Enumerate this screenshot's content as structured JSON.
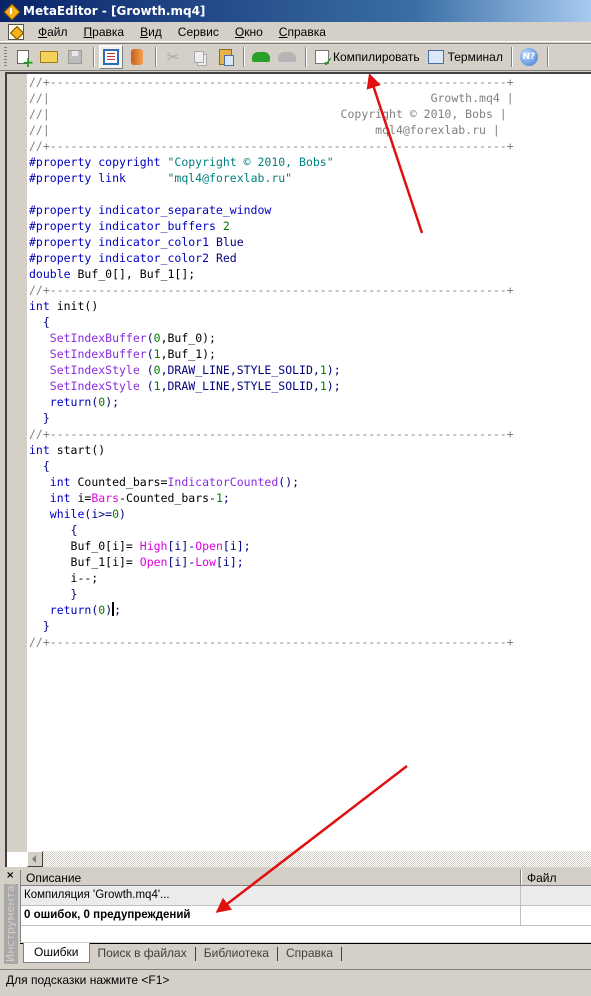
{
  "window": {
    "title": "MetaEditor - [Growth.mq4]"
  },
  "menu": {
    "items": [
      {
        "label": "Файл",
        "accel": "Ф",
        "rest": "айл"
      },
      {
        "label": "Правка",
        "accel": "П",
        "rest": "равка"
      },
      {
        "label": "Вид",
        "accel": "В",
        "rest": "ид"
      },
      {
        "label": "Сервис",
        "accel": "",
        "rest": "Сервис"
      },
      {
        "label": "Окно",
        "accel": "О",
        "rest": "кно"
      },
      {
        "label": "Справка",
        "accel": "С",
        "rest": "правка"
      }
    ]
  },
  "toolbar": {
    "compile_label": "Компилировать",
    "terminal_label": "Терминал",
    "help_glyph": "N?",
    "cut_glyph": "✂"
  },
  "editor": {
    "lines": [
      [
        {
          "t": "//+------------------------------------------------------------------+",
          "c": "com"
        }
      ],
      [
        {
          "t": "//|                                                       Growth.mq4 |",
          "c": "com"
        }
      ],
      [
        {
          "t": "//|                                          Copyright © 2010, Bobs |",
          "c": "com"
        }
      ],
      [
        {
          "t": "//|                                               mql4@forexlab.ru |",
          "c": "com"
        }
      ],
      [
        {
          "t": "//+------------------------------------------------------------------+",
          "c": "com"
        }
      ],
      [
        {
          "t": "#property copyright ",
          "c": "kw"
        },
        {
          "t": "\"Copyright © 2010, Bobs\"",
          "c": "str"
        }
      ],
      [
        {
          "t": "#property link      ",
          "c": "kw"
        },
        {
          "t": "\"mql4@forexlab.ru\"",
          "c": "str"
        }
      ],
      [
        {
          "t": "",
          "c": "txt"
        }
      ],
      [
        {
          "t": "#property indicator_separate_window",
          "c": "kw"
        }
      ],
      [
        {
          "t": "#property indicator_buffers ",
          "c": "kw"
        },
        {
          "t": "2",
          "c": "num"
        }
      ],
      [
        {
          "t": "#property indicator_color1 ",
          "c": "kw"
        },
        {
          "t": "Blue",
          "c": "id"
        }
      ],
      [
        {
          "t": "#property indicator_color2 ",
          "c": "kw"
        },
        {
          "t": "Red",
          "c": "id"
        }
      ],
      [
        {
          "t": "double ",
          "c": "kw"
        },
        {
          "t": "Buf_0[], Buf_1[];",
          "c": "txt"
        }
      ],
      [
        {
          "t": "//+------------------------------------------------------------------+",
          "c": "com"
        }
      ],
      [
        {
          "t": "int ",
          "c": "kw"
        },
        {
          "t": "init()",
          "c": "txt"
        }
      ],
      [
        {
          "t": "  {",
          "c": "id"
        }
      ],
      [
        {
          "t": "   SetIndexBuffer",
          "c": "fn"
        },
        {
          "t": "(",
          "c": "id"
        },
        {
          "t": "0",
          "c": "num"
        },
        {
          "t": ",Buf_0);",
          "c": "txt"
        }
      ],
      [
        {
          "t": "   SetIndexBuffer",
          "c": "fn"
        },
        {
          "t": "(",
          "c": "id"
        },
        {
          "t": "1",
          "c": "num"
        },
        {
          "t": ",Buf_1);",
          "c": "txt"
        }
      ],
      [
        {
          "t": "   SetIndexStyle ",
          "c": "fn"
        },
        {
          "t": "(",
          "c": "id"
        },
        {
          "t": "0",
          "c": "num"
        },
        {
          "t": ",DRAW_LINE,STYLE_SOLID,",
          "c": "id"
        },
        {
          "t": "1",
          "c": "num"
        },
        {
          "t": ");",
          "c": "id"
        }
      ],
      [
        {
          "t": "   SetIndexStyle ",
          "c": "fn"
        },
        {
          "t": "(",
          "c": "id"
        },
        {
          "t": "1",
          "c": "num"
        },
        {
          "t": ",DRAW_LINE,STYLE_SOLID,",
          "c": "id"
        },
        {
          "t": "1",
          "c": "num"
        },
        {
          "t": ");",
          "c": "id"
        }
      ],
      [
        {
          "t": "   return",
          "c": "kw"
        },
        {
          "t": "(",
          "c": "id"
        },
        {
          "t": "0",
          "c": "num"
        },
        {
          "t": ");",
          "c": "id"
        }
      ],
      [
        {
          "t": "  }",
          "c": "id"
        }
      ],
      [
        {
          "t": "//+------------------------------------------------------------------+",
          "c": "com"
        }
      ],
      [
        {
          "t": "int ",
          "c": "kw"
        },
        {
          "t": "start()",
          "c": "txt"
        }
      ],
      [
        {
          "t": "  {",
          "c": "id"
        }
      ],
      [
        {
          "t": "   int ",
          "c": "kw"
        },
        {
          "t": "Counted_bars=",
          "c": "txt"
        },
        {
          "t": "IndicatorCounted",
          "c": "fn"
        },
        {
          "t": "();",
          "c": "id"
        }
      ],
      [
        {
          "t": "   int ",
          "c": "kw"
        },
        {
          "t": "i=",
          "c": "txt"
        },
        {
          "t": "Bars",
          "c": "pre"
        },
        {
          "t": "-Counted_bars-",
          "c": "txt"
        },
        {
          "t": "1",
          "c": "num"
        },
        {
          "t": ";",
          "c": "id"
        }
      ],
      [
        {
          "t": "   while",
          "c": "kw"
        },
        {
          "t": "(i>=",
          "c": "id"
        },
        {
          "t": "0",
          "c": "num"
        },
        {
          "t": ")",
          "c": "id"
        }
      ],
      [
        {
          "t": "      {",
          "c": "id"
        }
      ],
      [
        {
          "t": "      Buf_0[i]= ",
          "c": "txt"
        },
        {
          "t": "High",
          "c": "pre"
        },
        {
          "t": "[i]-",
          "c": "id"
        },
        {
          "t": "Open",
          "c": "pre"
        },
        {
          "t": "[i];",
          "c": "id"
        }
      ],
      [
        {
          "t": "      Buf_1[i]= ",
          "c": "txt"
        },
        {
          "t": "Open",
          "c": "pre"
        },
        {
          "t": "[i]-",
          "c": "id"
        },
        {
          "t": "Low",
          "c": "pre"
        },
        {
          "t": "[i];",
          "c": "id"
        }
      ],
      [
        {
          "t": "      i--;",
          "c": "txt"
        }
      ],
      [
        {
          "t": "      }",
          "c": "id"
        }
      ],
      [
        {
          "t": "   return",
          "c": "kw"
        },
        {
          "t": "(",
          "c": "id"
        },
        {
          "t": "0",
          "c": "num"
        },
        {
          "t": ")",
          "c": "id"
        },
        {
          "t": "|caret|",
          "c": "caret"
        },
        {
          "t": ";",
          "c": "id"
        }
      ],
      [
        {
          "t": "  }",
          "c": "id"
        }
      ],
      [
        {
          "t": "//+------------------------------------------------------------------+",
          "c": "com"
        }
      ]
    ]
  },
  "toolbox": {
    "close_glyph": "×",
    "side_label": "Инструментарий",
    "columns": {
      "description": "Описание",
      "file": "Файл"
    },
    "rows": [
      {
        "description": "Компиляция 'Growth.mq4'...",
        "file": ""
      },
      {
        "description": "0 ошибок, 0 предупреждений",
        "file": ""
      }
    ],
    "tabs": [
      {
        "label": "Ошибки",
        "active": true
      },
      {
        "label": "Поиск в файлах",
        "active": false
      },
      {
        "label": "Библиотека",
        "active": false
      },
      {
        "label": "Справка",
        "active": false
      }
    ]
  },
  "status": {
    "hint": "Для подсказки нажмите <F1>"
  },
  "annotation": {
    "arrow_color": "#e01010"
  }
}
